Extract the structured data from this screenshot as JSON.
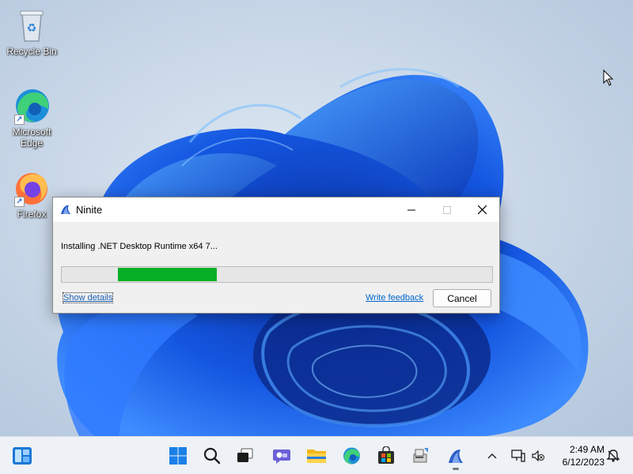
{
  "desktop": {
    "icons": [
      {
        "label": "Recycle Bin",
        "icon": "recycle-bin-icon"
      },
      {
        "label": "Microsoft Edge",
        "icon": "edge-icon"
      },
      {
        "label": "Firefox",
        "icon": "firefox-icon"
      }
    ]
  },
  "window": {
    "title": "Ninite",
    "status": "Installing .NET Desktop Runtime x64 7...",
    "progress": 0.23,
    "show_details": "Show details",
    "write_feedback": "Write feedback",
    "cancel": "Cancel"
  },
  "taskbar": {
    "items": [
      "widgets-icon",
      "start-icon",
      "search-icon",
      "task-view-icon",
      "chat-icon",
      "file-explorer-icon",
      "edge-icon",
      "store-icon",
      "installer-icon",
      "ninite-icon"
    ],
    "tray": [
      "chevron-up-icon",
      "network-icon",
      "volume-muted-icon",
      "notification-icon"
    ],
    "time": "2:49 AM",
    "date": "6/12/2023"
  },
  "colors": {
    "progress_fill": "#06b025",
    "link": "#0066cc",
    "accent_blue": "#1f5fe0"
  }
}
